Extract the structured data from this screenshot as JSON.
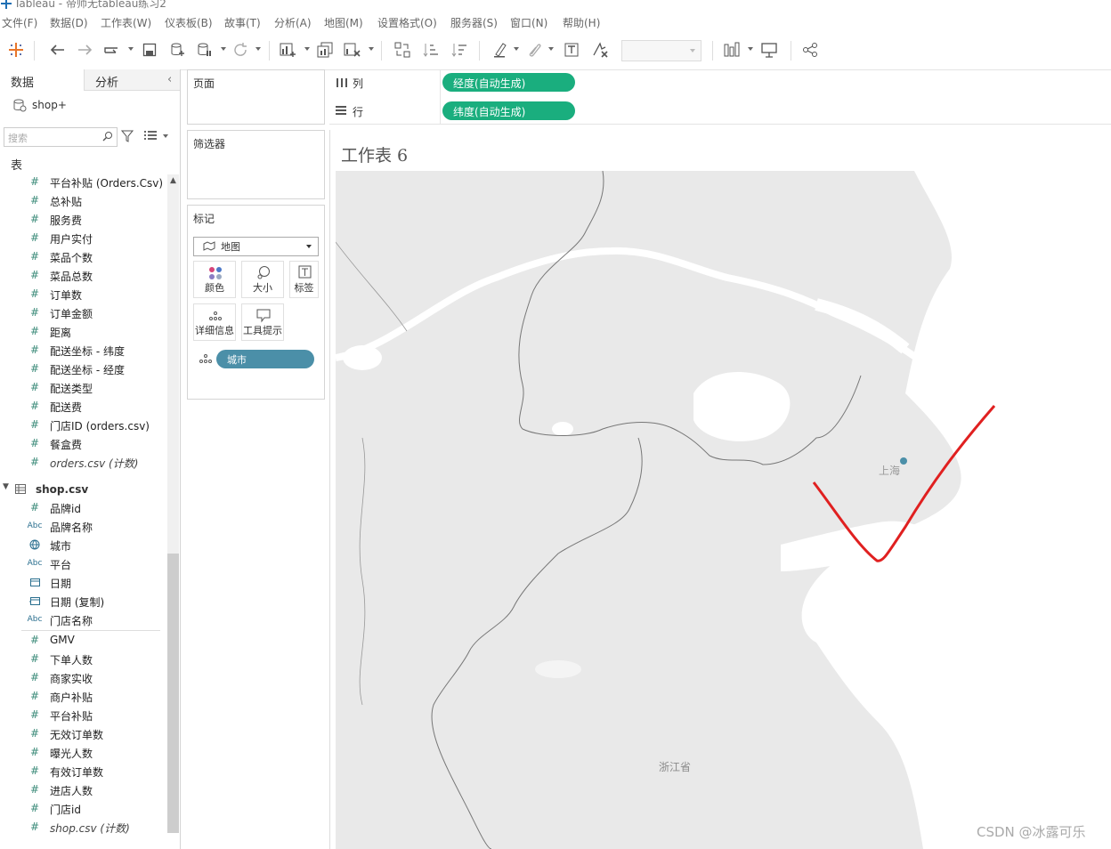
{
  "window": {
    "title": "Tableau - 帝师无tableau练习2"
  },
  "menu": [
    "文件(F)",
    "数据(D)",
    "工作表(W)",
    "仪表板(B)",
    "故事(T)",
    "分析(A)",
    "地图(M)",
    "设置格式(O)",
    "服务器(S)",
    "窗口(N)",
    "帮助(H)"
  ],
  "toolbar": {
    "undo": "undo-icon",
    "redo": "redo-icon"
  },
  "left_pane": {
    "tabs": [
      "数据",
      "分析"
    ],
    "datasource": "shop+",
    "search_placeholder": "搜索",
    "table_header": "表",
    "orders_fields": [
      {
        "icon": "#",
        "label": "平台补贴 (Orders.Csv)"
      },
      {
        "icon": "#",
        "label": "总补贴"
      },
      {
        "icon": "#",
        "label": "服务费"
      },
      {
        "icon": "#",
        "label": "用户实付"
      },
      {
        "icon": "#",
        "label": "菜品个数"
      },
      {
        "icon": "#",
        "label": "菜品总数"
      },
      {
        "icon": "#",
        "label": "订单数"
      },
      {
        "icon": "#",
        "label": "订单金额"
      },
      {
        "icon": "#",
        "label": "距离"
      },
      {
        "icon": "#",
        "label": "配送坐标 - 纬度"
      },
      {
        "icon": "#",
        "label": "配送坐标 - 经度"
      },
      {
        "icon": "#",
        "label": "配送类型"
      },
      {
        "icon": "#",
        "label": "配送费"
      },
      {
        "icon": "#",
        "label": "门店ID (orders.csv)"
      },
      {
        "icon": "#",
        "label": "餐盒费"
      },
      {
        "icon": "#",
        "label": "orders.csv (计数)",
        "italic": true
      }
    ],
    "shop_table": "shop.csv",
    "shop_dims": [
      {
        "icon": "#",
        "label": "品牌id"
      },
      {
        "icon": "Abc",
        "label": "品牌名称"
      },
      {
        "icon": "globe",
        "label": "城市"
      },
      {
        "icon": "Abc",
        "label": "平台"
      },
      {
        "icon": "cal",
        "label": "日期"
      },
      {
        "icon": "cal2",
        "label": "日期 (复制)"
      },
      {
        "icon": "Abc",
        "label": "门店名称"
      }
    ],
    "shop_measures": [
      {
        "icon": "#",
        "label": "GMV"
      },
      {
        "icon": "#",
        "label": "下单人数"
      },
      {
        "icon": "#",
        "label": "商家实收"
      },
      {
        "icon": "#",
        "label": "商户补贴"
      },
      {
        "icon": "#",
        "label": "平台补贴"
      },
      {
        "icon": "#",
        "label": "无效订单数"
      },
      {
        "icon": "#",
        "label": "曝光人数"
      },
      {
        "icon": "#",
        "label": "有效订单数"
      },
      {
        "icon": "#",
        "label": "进店人数"
      },
      {
        "icon": "#",
        "label": "门店id"
      },
      {
        "icon": "#",
        "label": "shop.csv (计数)",
        "italic": true
      }
    ]
  },
  "cards": {
    "pages": "页面",
    "filters": "筛选器",
    "marks": "标记",
    "mark_type": "地图",
    "mark_buttons": [
      "颜色",
      "大小",
      "标签",
      "详细信息",
      "工具提示"
    ],
    "detail_pill": "城市"
  },
  "shelves": {
    "columns_label": "列",
    "columns_pill": "经度(自动生成)",
    "rows_label": "行",
    "rows_pill": "纬度(自动生成)"
  },
  "view": {
    "sheet_title": "工作表 6",
    "map_labels": [
      "上海",
      "浙江省"
    ],
    "watermark": "CSDN @冰露可乐",
    "colors": {
      "pill_green": "#1aae7e",
      "pill_teal": "#4b8fa8",
      "annotation_red": "#e02020",
      "map_land": "#e9e9e9",
      "map_water": "#ffffff"
    }
  }
}
